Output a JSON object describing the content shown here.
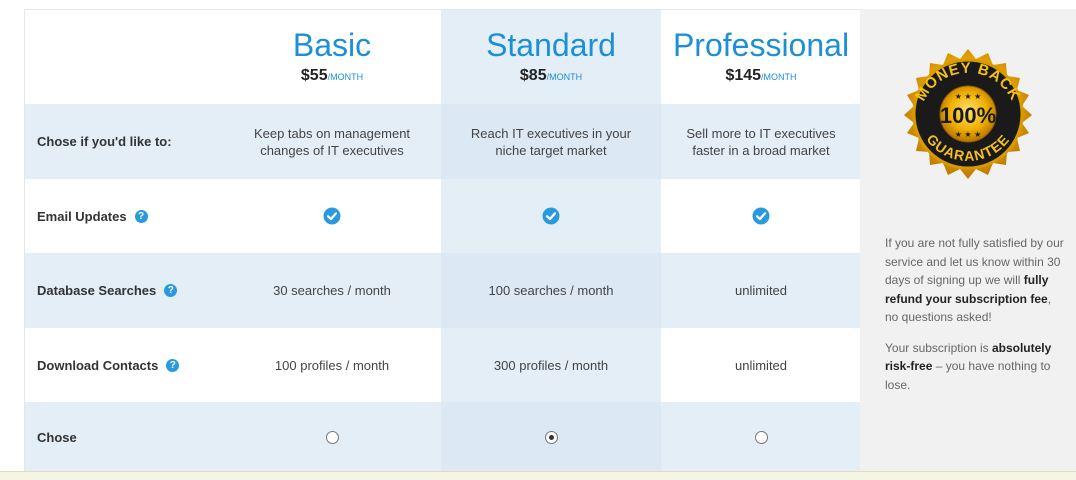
{
  "plans": [
    {
      "name": "Basic",
      "price": "$55",
      "per": "/MONTH"
    },
    {
      "name": "Standard",
      "price": "$85",
      "per": "/MONTH"
    },
    {
      "name": "Professional",
      "price": "$145",
      "per": "/MONTH"
    }
  ],
  "rows": {
    "choose": {
      "label": "Chose if you'd like to:",
      "values": [
        "Keep tabs on management changes of IT executives",
        "Reach IT executives in your niche target market",
        "Sell more to IT executives faster in a broad market"
      ]
    },
    "email": {
      "label": "Email Updates",
      "values": [
        "check",
        "check",
        "check"
      ]
    },
    "database": {
      "label": "Database Searches",
      "values": [
        "30 searches / month",
        "100 searches / month",
        "unlimited"
      ]
    },
    "download": {
      "label": "Download Contacts",
      "values": [
        "100 profiles / month",
        "300 profiles / month",
        "unlimited"
      ]
    },
    "select": {
      "label": "Chose",
      "selected": "Standard"
    }
  },
  "help_icon": "?",
  "badge": {
    "top": "MONEY BACK",
    "middle": "100%",
    "bottom": "GUARANTEE"
  },
  "guarantee": {
    "p1_start": "If you are not fully satisfied by our service and let us know within 30 days of signing up we will ",
    "p1_bold": "fully refund your subscription fee",
    "p1_end": ", no questions asked!",
    "p2_start": "Your subscription is ",
    "p2_bold": "absolutely risk-free",
    "p2_end": " – you have nothing to lose."
  },
  "colors": {
    "accent": "#1c8fd6",
    "row_blue": "#e4eef7",
    "badge_gold": "#e8a400",
    "badge_dark": "#1a1a1a"
  }
}
